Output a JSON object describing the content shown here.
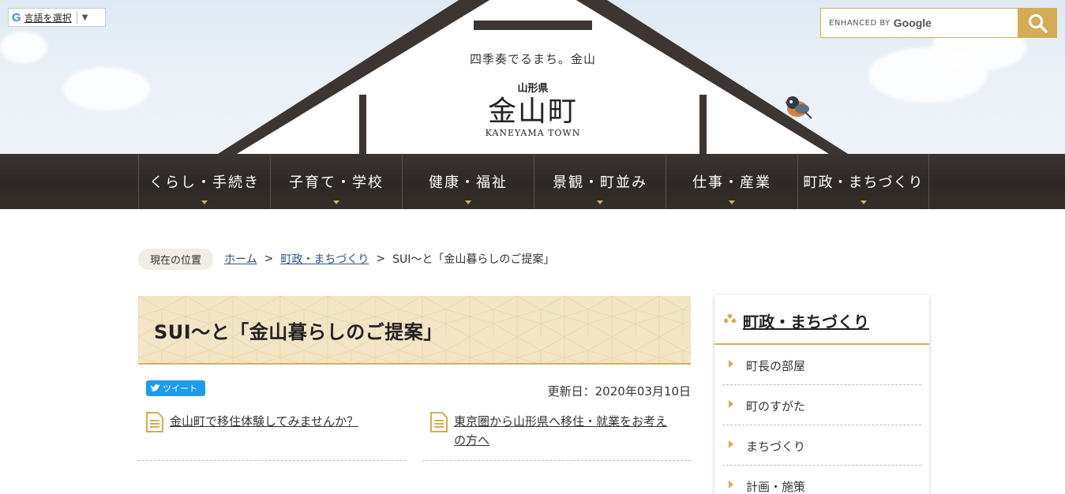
{
  "translate": {
    "label": "言語を選択",
    "logo": "G",
    "arrow": "▼"
  },
  "search": {
    "enhanced_by": "ENHANCED BY",
    "brand": "Google",
    "button_icon": "search-icon"
  },
  "logo": {
    "tagline": "四季奏でるまち。金山",
    "prefecture": "山形県",
    "town": "金山町",
    "roman": "KANEYAMA TOWN"
  },
  "nav": {
    "items": [
      {
        "label": "くらし・手続き"
      },
      {
        "label": "子育て・学校"
      },
      {
        "label": "健康・福祉"
      },
      {
        "label": "景観・町並み"
      },
      {
        "label": "仕事・産業"
      },
      {
        "label": "町政・まちづくり"
      }
    ]
  },
  "breadcrumb": {
    "current_label": "現在の位置",
    "home": "ホーム",
    "parent": "町政・まちづくり",
    "current": "SUI～と「金山暮らしのご提案」",
    "separator": ">"
  },
  "page": {
    "title": "SUI～と「金山暮らしのご提案」",
    "tweet": "ツイート",
    "updated": "更新日：2020年03月10日",
    "links": [
      {
        "label": "金山町で移住体験してみませんか？"
      },
      {
        "label_line1": "東京圏から山形県へ移住・就業をお考え",
        "label_line2": "の方へ"
      }
    ]
  },
  "sidebar": {
    "heading": "町政・まちづくり",
    "items": [
      {
        "label": "町長の部屋"
      },
      {
        "label": "町のすがた"
      },
      {
        "label": "まちづくり"
      },
      {
        "label": "計画・施策"
      }
    ]
  },
  "colors": {
    "accent": "#d3ac55",
    "nav_bg": "#2e2826",
    "title_bg": "#f3e6c7",
    "link": "#2b4d8c"
  }
}
